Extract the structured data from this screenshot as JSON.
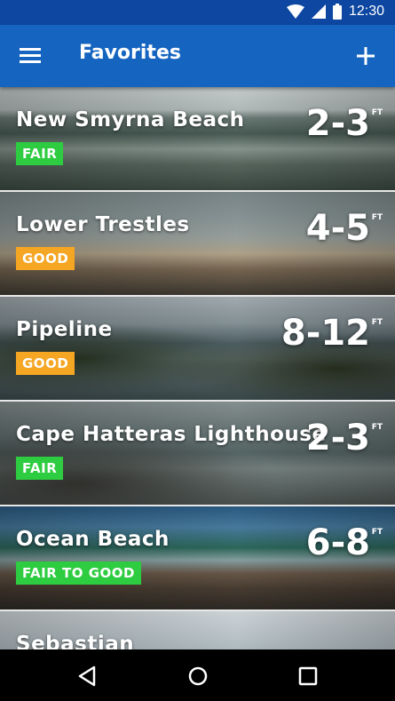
{
  "status_bar": {
    "time": "12:30"
  },
  "app_bar": {
    "title": "Favorites"
  },
  "spots": [
    {
      "name": "New Smyrna Beach",
      "rating": "FAIR",
      "height": "2-3",
      "unit": "FT"
    },
    {
      "name": "Lower Trestles",
      "rating": "GOOD",
      "height": "4-5",
      "unit": "FT"
    },
    {
      "name": "Pipeline",
      "rating": "GOOD",
      "height": "8-12",
      "unit": "FT"
    },
    {
      "name": "Cape Hatteras Lighthouse",
      "rating": "FAIR",
      "height": "2-3",
      "unit": "FT"
    },
    {
      "name": "Ocean Beach",
      "rating": "FAIR TO GOOD",
      "height": "6-8",
      "unit": "FT"
    },
    {
      "name": "Sebastian"
    }
  ],
  "colors": {
    "app_bar": "#1565c0",
    "status_bar": "#0d47a1",
    "fair": "#2ecc40",
    "good": "#f5a623"
  },
  "icons": [
    "wifi-icon",
    "signal-icon",
    "battery-icon",
    "menu-icon",
    "add-icon",
    "back-icon",
    "home-icon",
    "recents-icon"
  ]
}
